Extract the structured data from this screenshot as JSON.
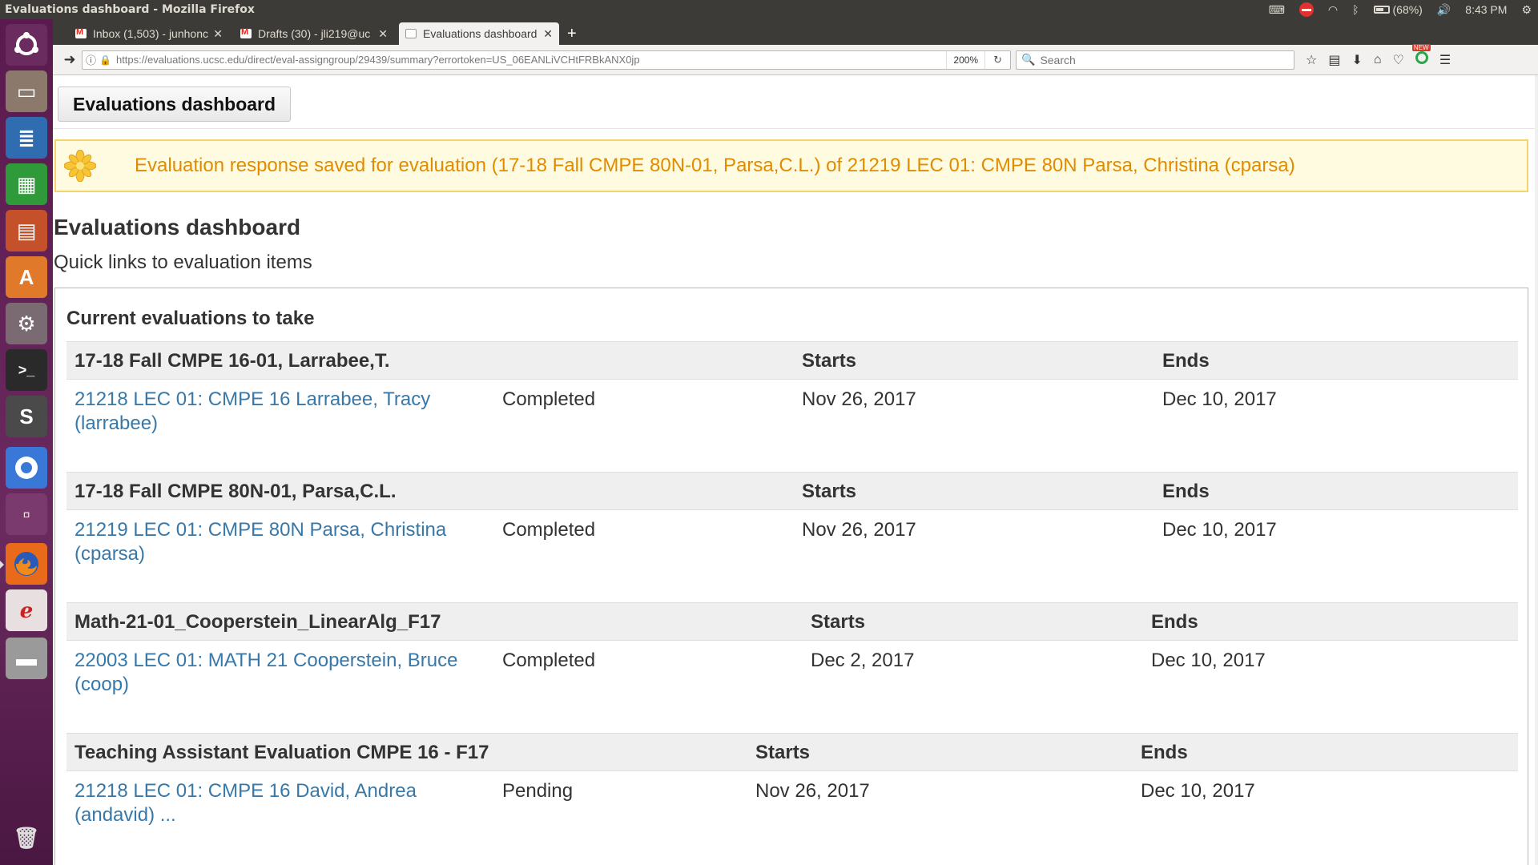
{
  "os": {
    "window_title": "Evaluations dashboard - Mozilla Firefox",
    "battery": "(68%)",
    "time": "8:43 PM"
  },
  "browser": {
    "tabs": [
      {
        "label": "Inbox (1,503) - junhonc",
        "icon": "gmail-icon"
      },
      {
        "label": "Drafts (30) - jli219@uc",
        "icon": "gmail-icon"
      },
      {
        "label": "Evaluations dashboard",
        "icon": "page-icon",
        "active": true
      }
    ],
    "url": "https://evaluations.ucsc.edu/direct/eval-assigngroup/29439/summary?errortoken=US_06EANLiVCHtFRBkANX0jp",
    "zoom": "200%",
    "search_placeholder": "Search"
  },
  "page": {
    "dash_button": "Evaluations dashboard",
    "alert": "Evaluation response saved for evaluation (17-18 Fall CMPE 80N-01, Parsa,C.L.) of 21219 LEC 01: CMPE 80N Parsa, Christina (cparsa)",
    "title": "Evaluations dashboard",
    "subtitle": "Quick links to evaluation items",
    "section_title": "Current evaluations to take",
    "groups": [
      {
        "name": "17-18 Fall CMPE 16-01, Larrabee,T.",
        "starts_label": "Starts",
        "ends_label": "Ends",
        "item": "21218 LEC 01: CMPE 16 Larrabee, Tracy (larrabee)",
        "status": "Completed",
        "start": "Nov 26, 2017",
        "end": "Dec 10, 2017"
      },
      {
        "name": "17-18 Fall CMPE 80N-01, Parsa,C.L.",
        "starts_label": "Starts",
        "ends_label": "Ends",
        "item": "21219 LEC 01: CMPE 80N Parsa, Christina (cparsa)",
        "status": "Completed",
        "start": "Nov 26, 2017",
        "end": "Dec 10, 2017"
      },
      {
        "name": "Math-21-01_Cooperstein_LinearAlg_F17",
        "starts_label": "Starts",
        "ends_label": "Ends",
        "item": "22003 LEC 01: MATH 21 Cooperstein, Bruce (coop)",
        "status": "Completed",
        "start": "Dec 2, 2017",
        "end": "Dec 10, 2017"
      },
      {
        "name": "Teaching Assistant Evaluation CMPE 16 - F17",
        "starts_label": "Starts",
        "ends_label": "Ends",
        "item": "21218 LEC 01: CMPE 16 David, Andrea (andavid) ...",
        "status": "Pending",
        "start": "Nov 26, 2017",
        "end": "Dec 10, 2017"
      }
    ]
  },
  "colors": {
    "link": "#3878a8",
    "alert_text": "#e08c00",
    "alert_bg": "#fffbe0",
    "launcher": "#5a1a4e"
  }
}
